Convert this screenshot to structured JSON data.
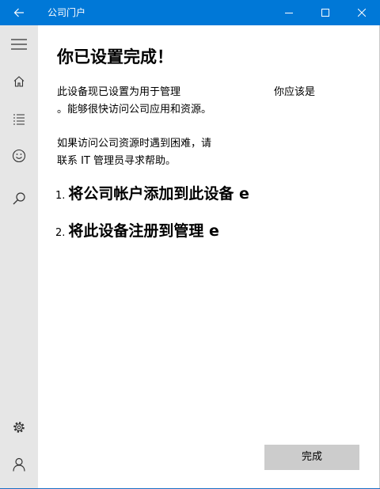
{
  "window": {
    "title": "公司门户",
    "controls": [
      "back-icon",
      "minimize-icon",
      "maximize-icon",
      "close-icon"
    ]
  },
  "sidebar": {
    "items": [
      {
        "icon": "hamburger-menu-icon"
      },
      {
        "icon": "home-icon"
      },
      {
        "icon": "list-icon"
      },
      {
        "icon": "smiley-icon"
      },
      {
        "icon": "search-icon"
      },
      {
        "icon": "settings-gear-icon"
      },
      {
        "icon": "account-person-icon"
      }
    ]
  },
  "main": {
    "heading": "你已设置完成！",
    "intro": {
      "line1_left": "此设备现已设置为用于管理",
      "line1_right": "你应该是",
      "line2": "。能够很快访问公司应用和资源。"
    },
    "help": {
      "line1": "如果访问公司资源时遇到困难，请",
      "line2": "联系 IT 管理员寻求帮助。"
    },
    "steps": [
      {
        "number": "1.",
        "text": "将公司帐户添加到此设备 e"
      },
      {
        "number": "2.",
        "text": "将此设备注册到管理 e"
      }
    ],
    "done_label": "完成"
  },
  "colors": {
    "titlebar": "#0078d7",
    "sidebar": "#e6e6e6",
    "button": "#cccccc"
  }
}
